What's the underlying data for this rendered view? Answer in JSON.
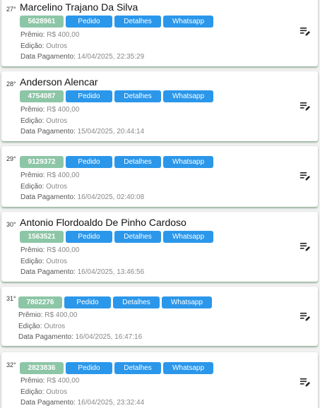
{
  "labels": {
    "pedido": "Pedido",
    "detalhes": "Detalhes",
    "whatsapp": "Whatsapp",
    "premio": "Prêmio:",
    "edicao": "Edição:",
    "data_pagamento": "Data Pagamento:"
  },
  "entries": [
    {
      "rank": "27°",
      "name": "Marcelino Trajano Da Silva",
      "code": "5628961",
      "premio": "R$ 400,00",
      "edicao": "Outros",
      "data_pagamento": "14/04/2025, 22:35:29"
    },
    {
      "rank": "28°",
      "name": "Anderson Alencar",
      "code": "4754087",
      "premio": "R$ 400,00",
      "edicao": "Outros",
      "data_pagamento": "15/04/2025, 20:44:14"
    },
    {
      "rank": "29°",
      "name": "",
      "code": "9129372",
      "premio": "R$ 400,00",
      "edicao": "Outros",
      "data_pagamento": "16/04/2025, 02:40:08"
    },
    {
      "rank": "30°",
      "name": "Antonio Flordoaldo De Pinho Cardoso",
      "code": "1563521",
      "premio": "R$ 400,00",
      "edicao": "Outros",
      "data_pagamento": "16/04/2025, 13:46:56"
    },
    {
      "rank": "31°",
      "name": "",
      "code": "7802276",
      "premio": "R$ 400,00",
      "edicao": "Outros",
      "data_pagamento": "16/04/2025, 16:47:16"
    },
    {
      "rank": "32°",
      "name": "",
      "code": "2823836",
      "premio": "R$ 400,00",
      "edicao": "Outros",
      "data_pagamento": "16/04/2025, 23:32:44"
    }
  ],
  "icons": {
    "edit": "edit-list-icon"
  },
  "colors": {
    "accent_blue": "#2b97ea",
    "code_green": "#8cc6a6",
    "card_shadow": "#3c6e46"
  }
}
